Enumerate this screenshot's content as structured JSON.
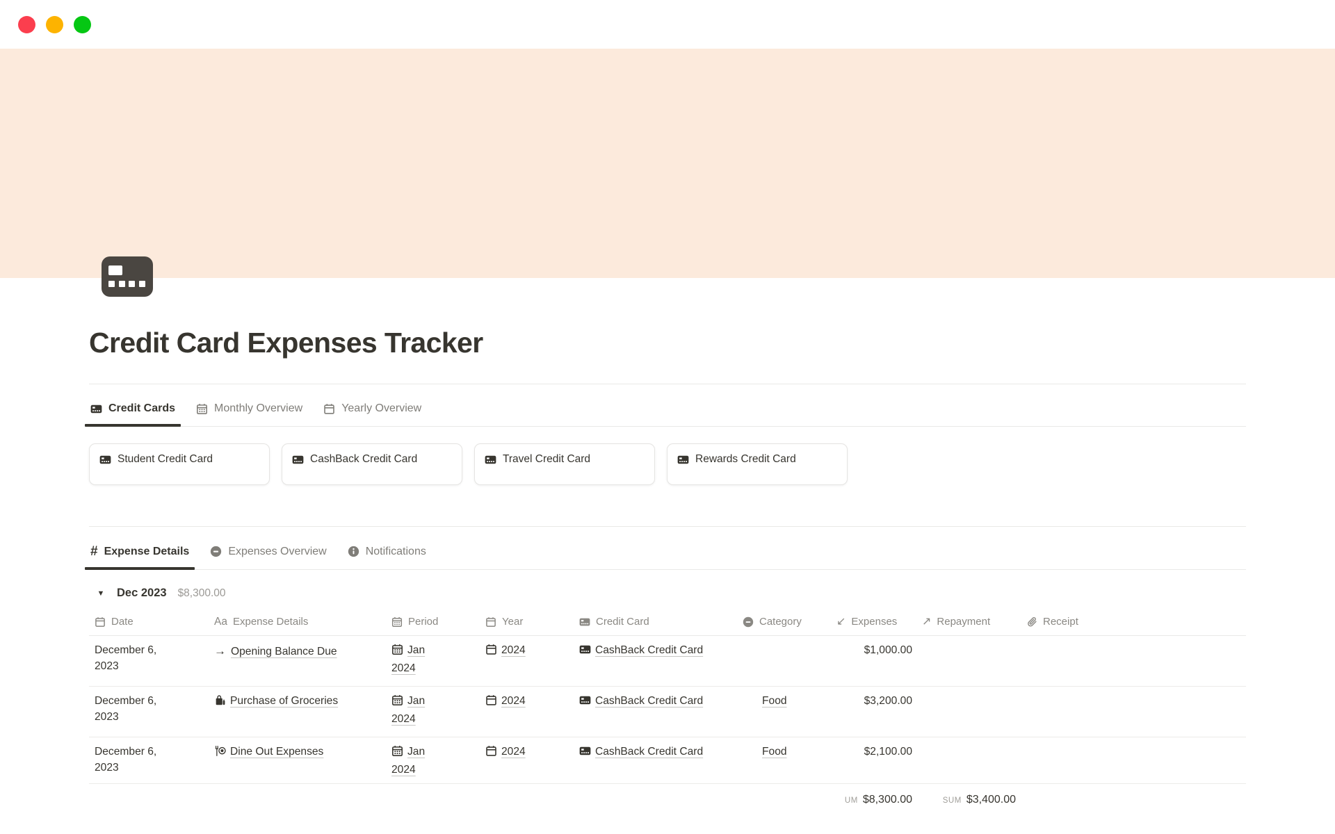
{
  "window": {
    "controls": [
      {
        "name": "close",
        "color": "#fb3e4e"
      },
      {
        "name": "minimize",
        "color": "#fdb300"
      },
      {
        "name": "zoom",
        "color": "#05c713"
      }
    ]
  },
  "page": {
    "cover_color": "#fceadc",
    "icon": "credit-card",
    "title": "Credit Card Expenses Tracker"
  },
  "glyphs": {
    "toggle": "▼",
    "hash": "#",
    "text_prop": "Aa",
    "arrow_right": "→",
    "arrow_down_left": "↙",
    "arrow_up_right": "↗"
  },
  "view_tabs": {
    "items": [
      {
        "label": "Credit Cards",
        "icon": "credit-card-icon",
        "active": true
      },
      {
        "label": "Monthly Overview",
        "icon": "calendar-grid-icon",
        "active": false
      },
      {
        "label": "Yearly Overview",
        "icon": "calendar-icon",
        "active": false
      }
    ]
  },
  "credit_cards": {
    "items": [
      {
        "label": "Student Credit Card",
        "icon": "credit-card-icon"
      },
      {
        "label": "CashBack Credit Card",
        "icon": "credit-card-icon"
      },
      {
        "label": "Travel Credit Card",
        "icon": "credit-card-icon"
      },
      {
        "label": "Rewards Credit Card",
        "icon": "credit-card-icon"
      }
    ]
  },
  "section_tabs": {
    "items": [
      {
        "label": "Expense Details",
        "icon": "hash-icon",
        "active": true
      },
      {
        "label": "Expenses Overview",
        "icon": "minus-circle-icon",
        "active": false
      },
      {
        "label": "Notifications",
        "icon": "info-circle-icon",
        "active": false
      }
    ]
  },
  "group": {
    "label": "Dec 2023",
    "total": "$8,300.00"
  },
  "table": {
    "columns": [
      {
        "label": "Date",
        "icon": "calendar-icon"
      },
      {
        "label": "Expense Details",
        "icon": "text-icon"
      },
      {
        "label": "Period",
        "icon": "calendar-grid-icon"
      },
      {
        "label": "Year",
        "icon": "calendar-icon"
      },
      {
        "label": "Credit Card",
        "icon": "credit-card-icon"
      },
      {
        "label": "Category",
        "icon": "minus-circle-icon"
      },
      {
        "label": "Expenses",
        "icon": "arrow-down-left-icon"
      },
      {
        "label": "Repayment",
        "icon": "arrow-up-right-icon"
      },
      {
        "label": "Receipt",
        "icon": "paperclip-icon"
      }
    ],
    "rows": [
      {
        "date": "December 6, 2023",
        "details": "Opening Balance Due",
        "details_icon": "arrow-right-icon",
        "period": "Jan 2024",
        "year": "2024",
        "credit_card": "CashBack Credit Card",
        "category": "",
        "expenses": "$1,000.00",
        "repayment": "",
        "receipt": ""
      },
      {
        "date": "December 6, 2023",
        "details": "Purchase of Groceries",
        "details_icon": "shopping-bag-icon",
        "period": "Jan 2024",
        "year": "2024",
        "credit_card": "CashBack Credit Card",
        "category": "Food",
        "expenses": "$3,200.00",
        "repayment": "",
        "receipt": ""
      },
      {
        "date": "December 6, 2023",
        "details": "Dine Out Expenses",
        "details_icon": "dining-icon",
        "period": "Jan 2024",
        "year": "2024",
        "credit_card": "CashBack Credit Card",
        "category": "Food",
        "expenses": "$2,100.00",
        "repayment": "",
        "receipt": ""
      }
    ],
    "footer": {
      "expenses_sum_label": "UM",
      "expenses_sum": "$8,300.00",
      "repayment_sum_label": "SUM",
      "repayment_sum": "$3,400.00"
    }
  },
  "colors": {
    "text": "#37352f",
    "muted": "#7f7d78",
    "border": "#e9e9e7"
  }
}
